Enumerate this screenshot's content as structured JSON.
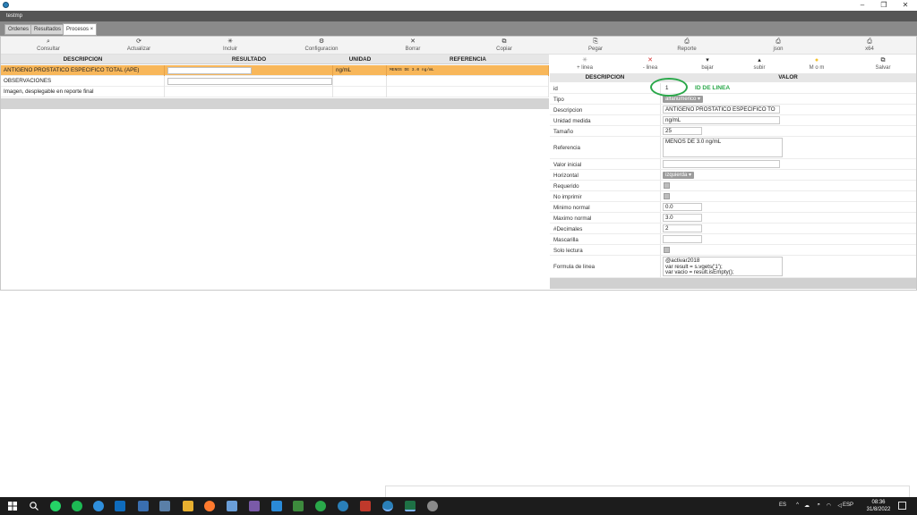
{
  "window": {
    "title": "testmp"
  },
  "tabs": [
    {
      "label": "Ordenes"
    },
    {
      "label": "Resultados"
    },
    {
      "label": "Procesos ×"
    }
  ],
  "toolbar": [
    {
      "icon": "search-icon",
      "glyph": "⌕",
      "label": "Consultar"
    },
    {
      "icon": "refresh-icon",
      "glyph": "⟳",
      "label": "Actualizar"
    },
    {
      "icon": "star-icon",
      "glyph": "✳",
      "label": "Incluir"
    },
    {
      "icon": "gear-icon",
      "glyph": "⚙",
      "label": "Configuracion"
    },
    {
      "icon": "close-icon",
      "glyph": "✕",
      "label": "Borrar"
    },
    {
      "icon": "copy-icon",
      "glyph": "⧉",
      "label": "Copiar"
    },
    {
      "icon": "paste-icon",
      "glyph": "⎘",
      "label": "Pegar"
    },
    {
      "icon": "print-icon",
      "glyph": "⎙",
      "label": "Reporte"
    },
    {
      "icon": "print-icon",
      "glyph": "⎙",
      "label": "json"
    },
    {
      "icon": "print-icon",
      "glyph": "⎙",
      "label": "x64"
    }
  ],
  "left_table": {
    "headers": [
      "DESCRIPCION",
      "RESULTADO",
      "UNIDAD",
      "REFERENCIA"
    ],
    "rows": [
      {
        "descripcion": "ANTIGENO PROSTATICO ESPECIFICO TOTAL (APE)",
        "unidad": "ng/mL",
        "referencia": "MENOS DE 3.0 ng/mL"
      },
      {
        "descripcion": "OBSERVACIONES",
        "unidad": "",
        "referencia": ""
      },
      {
        "descripcion": "Imagen, desplegable en reporte final",
        "unidad": "",
        "referencia": ""
      }
    ]
  },
  "right_toolbar": [
    {
      "icon": "add-line-icon",
      "glyph": "✳",
      "label": "+ linea"
    },
    {
      "icon": "remove-line-icon",
      "glyph": "✕",
      "label": "- linea"
    },
    {
      "icon": "arrow-down-icon",
      "glyph": "▾",
      "label": "bajar"
    },
    {
      "icon": "arrow-up-icon",
      "glyph": "▴",
      "label": "subir"
    },
    {
      "icon": "bulb-icon",
      "glyph": "●",
      "label": "M o m"
    },
    {
      "icon": "save-icon",
      "glyph": "⧉",
      "label": "Salvar"
    }
  ],
  "properties": {
    "headers": [
      "DESCRIPCION",
      "VALOR"
    ],
    "rows": [
      {
        "label": "id",
        "value": "1"
      },
      {
        "label": "Tipo",
        "value": "alfanumerico ▾"
      },
      {
        "label": "Descripcion",
        "value": "ANTIGENO PROSTATICO ESPECIFICO TO"
      },
      {
        "label": "Unidad medida",
        "value": "ng/mL"
      },
      {
        "label": "Tamaño",
        "value": "25"
      },
      {
        "label": "Referencia",
        "value": "MENOS DE 3.0 ng/mL"
      },
      {
        "label": "Valor inicial",
        "value": ""
      },
      {
        "label": "Horizontal",
        "value": "izquierda ▾"
      },
      {
        "label": "Requerido",
        "value": ""
      },
      {
        "label": "No imprimir",
        "value": ""
      },
      {
        "label": "Minimo normal",
        "value": "0.0"
      },
      {
        "label": "Maximo normal",
        "value": "3.0"
      },
      {
        "label": "#Decimales",
        "value": "2"
      },
      {
        "label": "Mascarilla",
        "value": ""
      },
      {
        "label": "Solo lectura",
        "value": ""
      },
      {
        "label": "Formula de linea",
        "value": "@activar2018\nvar result = s.vgets('1');\nvar vacio = result.isEmpty();"
      }
    ]
  },
  "annotation": {
    "text": "ID DE LINEA",
    "color": "#2aa84a"
  },
  "taskbar": {
    "tray_lang": "ES",
    "lang": "ESP",
    "time": "08:36",
    "date": "31/8/2022"
  },
  "colors": {
    "selected_row": "#f8b75a",
    "dark_bar": "#555555",
    "tab_bar": "#8a8a8a"
  }
}
